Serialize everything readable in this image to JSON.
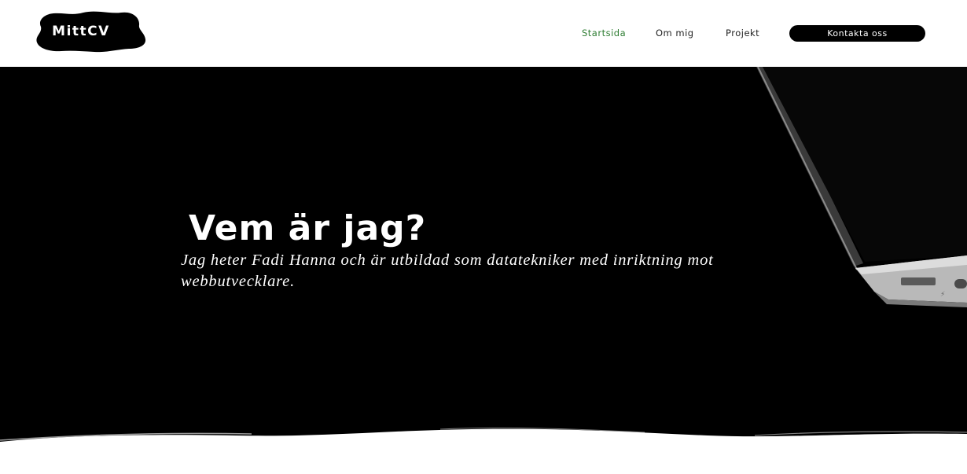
{
  "header": {
    "logo_text": "MittCV",
    "nav": [
      {
        "label": "Startsida",
        "active": true
      },
      {
        "label": "Om mig",
        "active": false
      },
      {
        "label": "Projekt",
        "active": false
      }
    ],
    "cta_label": "Kontakta oss"
  },
  "hero": {
    "title": "Vem är jag?",
    "description": "Jag heter Fadi Hanna och är utbildad som datatekniker med inriktning mot webbutvecklare.",
    "background_image": "laptop-image"
  },
  "colors": {
    "active_nav": "#2e7d32",
    "hero_background": "#000000",
    "cta_background": "#000000",
    "text_light": "#ffffff"
  }
}
